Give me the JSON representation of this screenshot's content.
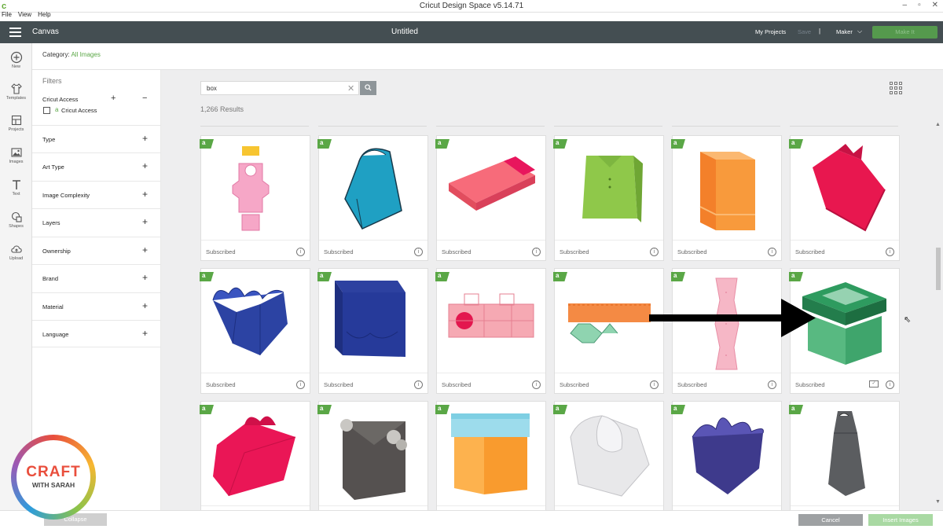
{
  "window": {
    "title": "Cricut Design Space  v5.14.71",
    "logo": "c",
    "controls": [
      "–",
      "▫",
      "✕"
    ]
  },
  "menu": [
    "File",
    "View",
    "Help"
  ],
  "header": {
    "section": "Canvas",
    "title": "Untitled",
    "my_projects": "My Projects",
    "save": "Save",
    "separator": "|",
    "machine": "Maker",
    "make_it": "Make It"
  },
  "rail": [
    {
      "label": "New",
      "icon": "plus-circle-icon"
    },
    {
      "label": "Templates",
      "icon": "shirt-icon"
    },
    {
      "label": "Projects",
      "icon": "projects-icon"
    },
    {
      "label": "Images",
      "icon": "images-icon"
    },
    {
      "label": "Text",
      "icon": "text-icon"
    },
    {
      "label": "Shapes",
      "icon": "shapes-icon"
    },
    {
      "label": "Upload",
      "icon": "upload-icon"
    }
  ],
  "category": {
    "label": "Category:",
    "value": "All Images"
  },
  "filters": {
    "title": "Filters",
    "cricut_access": {
      "title": "Cricut Access",
      "option": "Cricut Access"
    },
    "groups": [
      "Type",
      "Art Type",
      "Image Complexity",
      "Layers",
      "Ownership",
      "Brand",
      "Material",
      "Language"
    ]
  },
  "search": {
    "query": "box",
    "results": "1,266 Results"
  },
  "tiles": [
    {
      "label": "Subscribed",
      "art": "pink-template",
      "row": 0,
      "col": 0
    },
    {
      "label": "Subscribed",
      "art": "blue-bag",
      "row": 0,
      "col": 1
    },
    {
      "label": "Subscribed",
      "art": "pink-slide-box",
      "row": 0,
      "col": 2
    },
    {
      "label": "Subscribed",
      "art": "green-shirt-bag",
      "row": 0,
      "col": 3
    },
    {
      "label": "Subscribed",
      "art": "orange-tall-box",
      "row": 0,
      "col": 4
    },
    {
      "label": "Subscribed",
      "art": "red-heart-box",
      "row": 0,
      "col": 5
    },
    {
      "label": "Subscribed",
      "art": "navy-flower-box",
      "row": 1,
      "col": 0
    },
    {
      "label": "Subscribed",
      "art": "navy-square-box",
      "row": 1,
      "col": 1
    },
    {
      "label": "Subscribed",
      "art": "pink-net",
      "row": 1,
      "col": 2
    },
    {
      "label": "Subscribed",
      "art": "orange-green-net",
      "row": 1,
      "col": 3
    },
    {
      "label": "Subscribed",
      "art": "pink-strip",
      "row": 1,
      "col": 4
    },
    {
      "label": "Subscribed",
      "art": "green-window-box",
      "row": 1,
      "col": 5,
      "checked": true
    },
    {
      "label": "",
      "art": "red-handle-box",
      "row": 2,
      "col": 0
    },
    {
      "label": "",
      "art": "gray-floral-bag",
      "row": 2,
      "col": 1
    },
    {
      "label": "",
      "art": "blue-orange-box",
      "row": 2,
      "col": 2
    },
    {
      "label": "",
      "art": "white-curved-box",
      "row": 2,
      "col": 3
    },
    {
      "label": "",
      "art": "purple-flower-box",
      "row": 2,
      "col": 4
    },
    {
      "label": "",
      "art": "gray-tall-bag",
      "row": 2,
      "col": 5
    }
  ],
  "footer": {
    "left_button": "Collapse",
    "cancel": "Cancel",
    "insert": "Insert Images"
  },
  "watermark": {
    "line1": "CRAFT",
    "line2": "WITH SARAH"
  },
  "colors": {
    "header": "#444e52",
    "accent": "#5aa746",
    "grid_bg": "#eeeeef"
  }
}
